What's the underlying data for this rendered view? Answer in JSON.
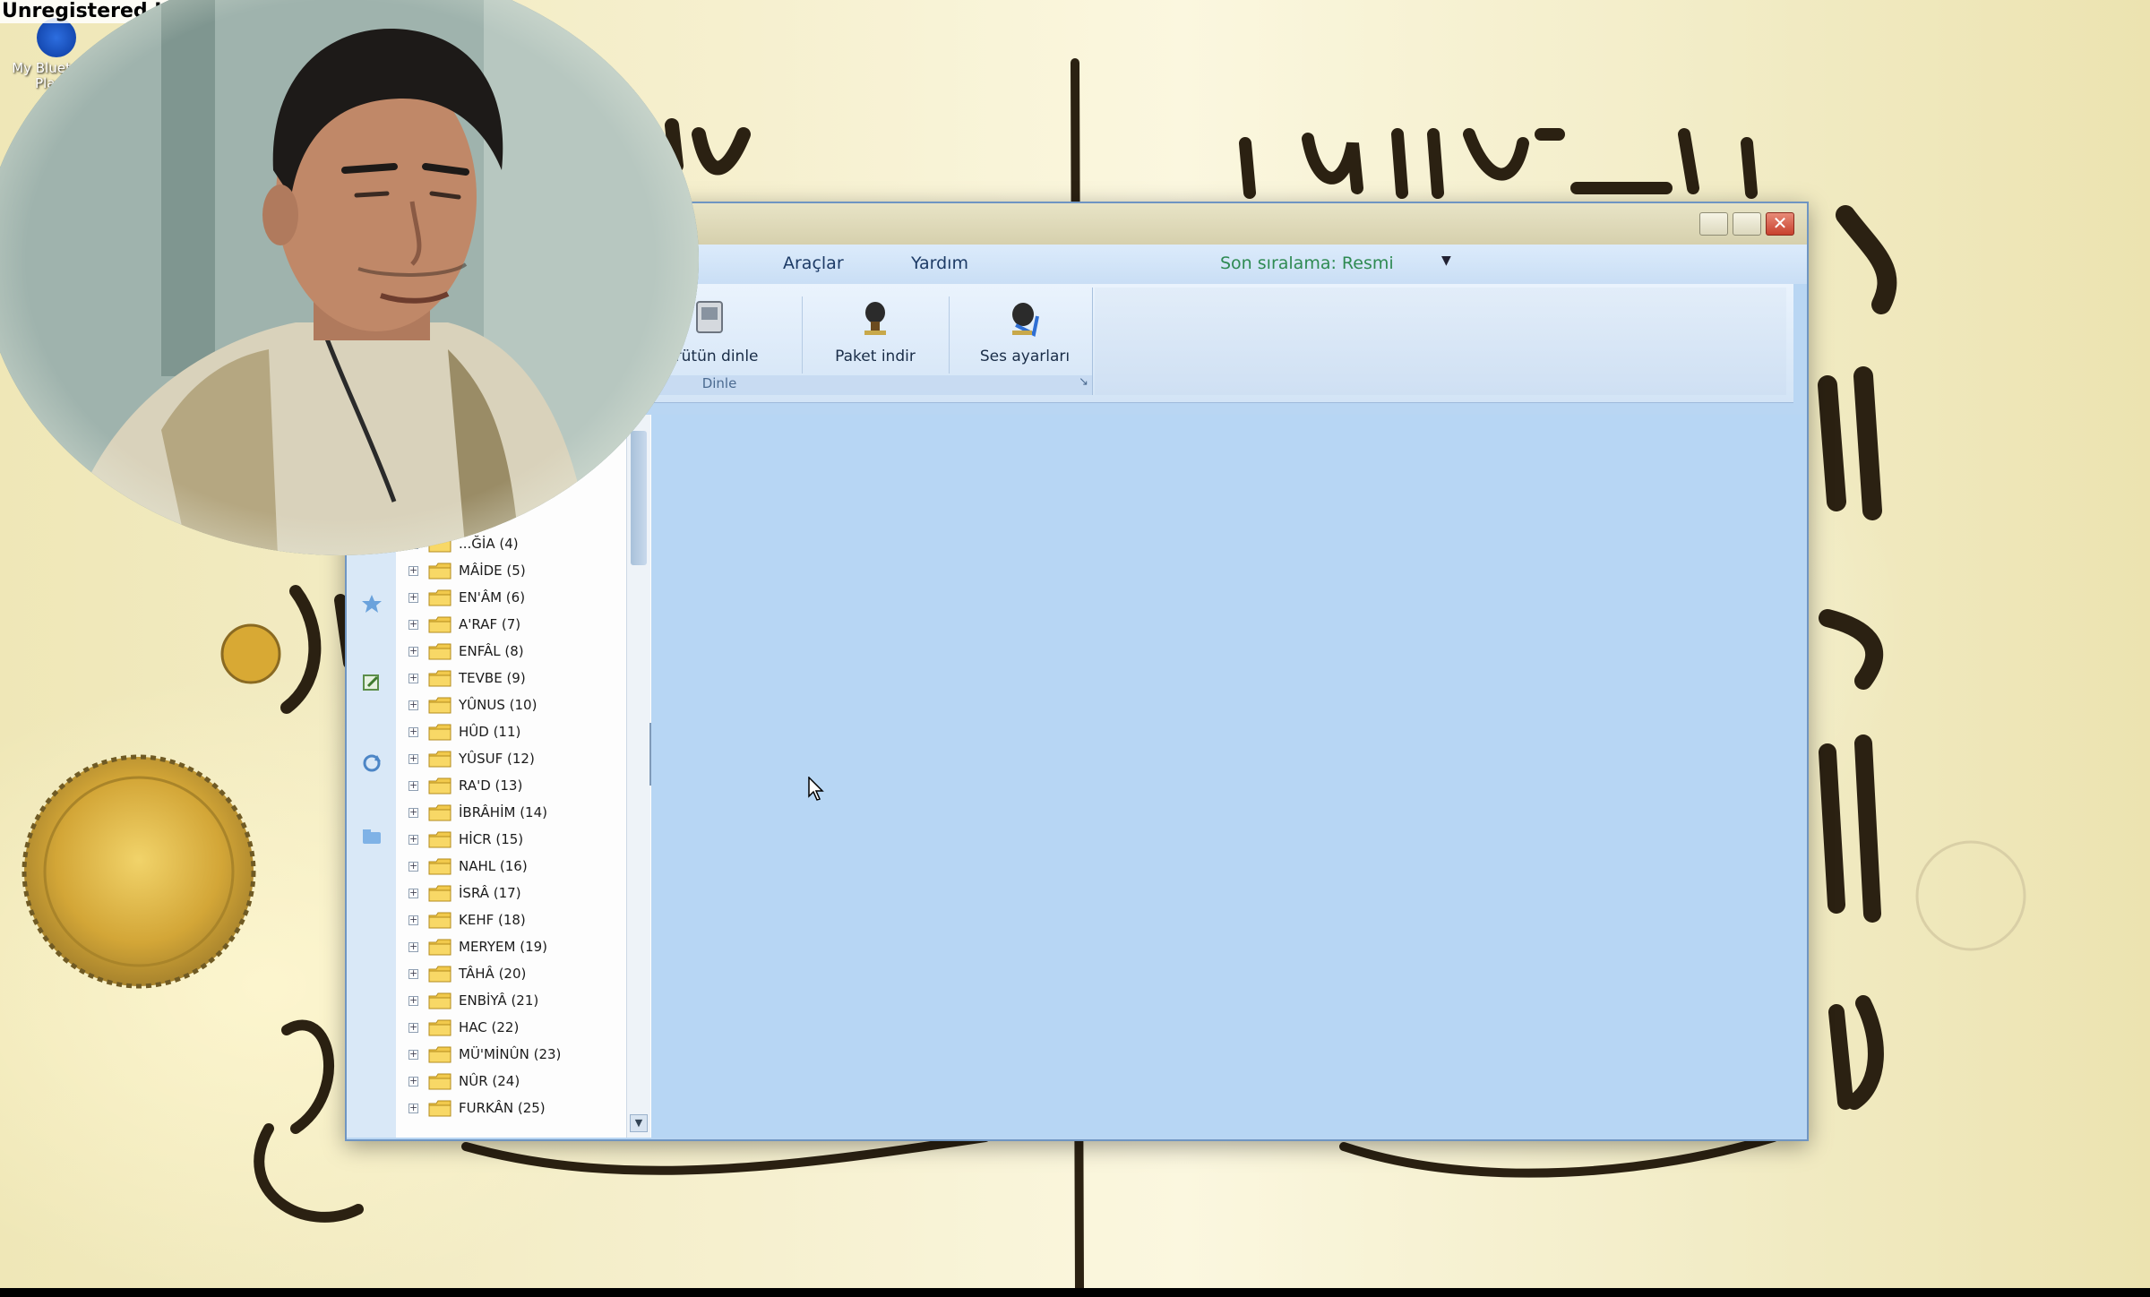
{
  "recorder": {
    "watermark": "Unregistered HyperCam 2"
  },
  "desktop": {
    "icons": [
      {
        "label": "My Bluetooth Places",
        "icon": "bluetooth-icon"
      },
      {
        "label": "",
        "icon": "computer-icon"
      },
      {
        "label": "",
        "icon": "recycle-bin-icon"
      }
    ]
  },
  "window": {
    "title": "",
    "menu": [
      "Araçlar",
      "Yardım"
    ],
    "recent_label": "Son sıralama: Resmi",
    "ribbon": {
      "buttons": [
        {
          "label": "...rütün dinle",
          "icon": "listen-icon"
        },
        {
          "label": "Paket indir",
          "icon": "package-download-icon"
        },
        {
          "label": "Ses ayarları",
          "icon": "sound-settings-icon"
        }
      ],
      "group_caption": "Dinle"
    },
    "tree": [
      "...ĞİA (4)",
      "MÂİDE (5)",
      "EN'ÂM (6)",
      "A'RAF (7)",
      "ENFÂL (8)",
      "TEVBE (9)",
      "YÛNUS (10)",
      "HÛD (11)",
      "YÛSUF (12)",
      "RA'D (13)",
      "İBRÂHİM (14)",
      "HİCR (15)",
      "NAHL (16)",
      "İSRÂ (17)",
      "KEHF (18)",
      "MERYEM (19)",
      "TÂHÂ (20)",
      "ENBİYÂ (21)",
      "HAC (22)",
      "MÜ'MİNÛN (23)",
      "NÛR (24)",
      "FURKÂN (25)"
    ]
  },
  "colors": {
    "window_bg": "#b9d6f3",
    "recent_text": "#2e8a52",
    "close_button": "#c8412e"
  }
}
